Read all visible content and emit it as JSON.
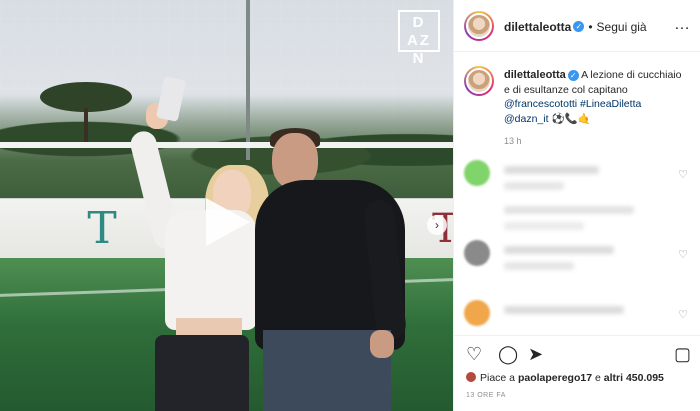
{
  "media": {
    "watermark": "DAZN",
    "play_icon": "play-icon",
    "next_icon": "chevron-right-icon"
  },
  "header": {
    "username": "dilettaleotta",
    "follow_label": "Segui già",
    "separator": "•",
    "more_icon": "ellipsis-icon"
  },
  "caption": {
    "username": "dilettaleotta",
    "text": "A lezione di cucchiaio e di esultanze col capitano",
    "mention_1": "@francescototti",
    "hashtag": "#LineaDiletta",
    "mention_2": "@dazn_it",
    "emojis": "⚽📞🤙",
    "time_ago": "13 h"
  },
  "comments": [
    {
      "avatar_color": "#7fd46a"
    },
    {
      "avatar_color": "#8a8a8a"
    },
    {
      "avatar_color": "#f0a64a"
    }
  ],
  "actions": {
    "like_icon": "heart-icon",
    "comment_icon": "comment-icon",
    "share_icon": "share-icon",
    "save_icon": "bookmark-icon",
    "likes_prefix": "Piace a ",
    "likes_user": "paolaperego17",
    "likes_mid": " e ",
    "likes_count": "altri 450.095",
    "date": "13 ORE FA"
  },
  "colors": {
    "verified": "#3897f0",
    "link": "#003569",
    "muted": "#8e8e8e"
  }
}
